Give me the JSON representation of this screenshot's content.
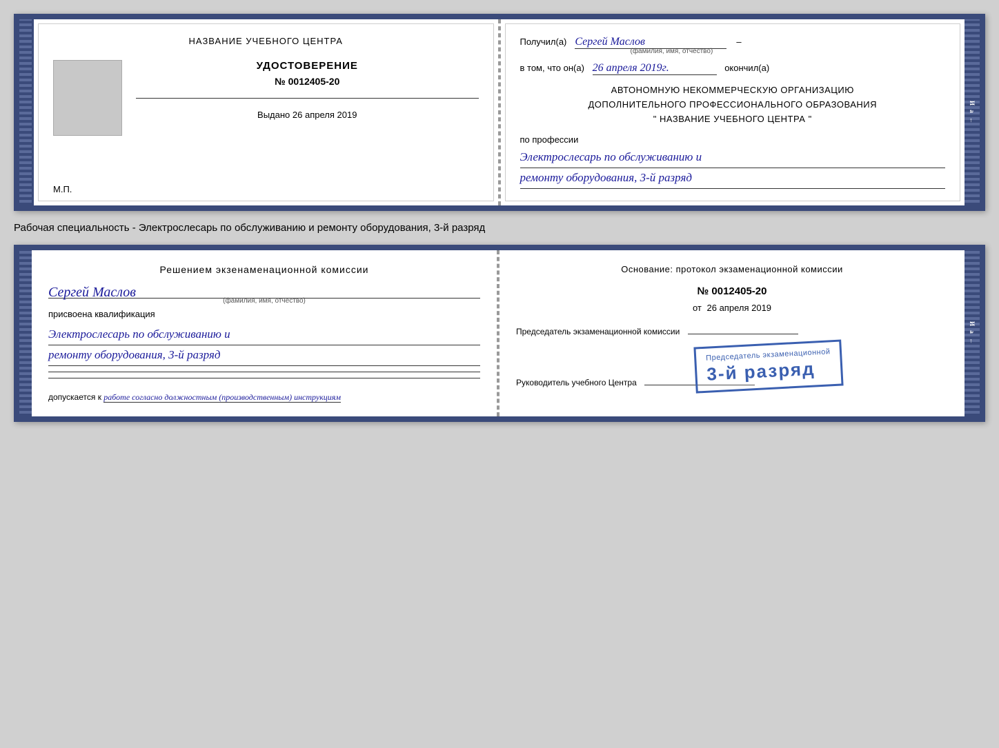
{
  "top_cert": {
    "left": {
      "heading": "НАЗВАНИЕ УЧЕБНОГО ЦЕНТРА",
      "cert_title": "УДОСТОВЕРЕНИЕ",
      "cert_number": "№ 0012405-20",
      "issued_label": "Выдано",
      "issued_date": "26 апреля 2019",
      "mp_label": "М.П."
    },
    "right": {
      "received_label": "Получил(а)",
      "fio_handwritten": "Сергей Маслов",
      "fio_subtitle": "(фамилия, имя, отчество)",
      "dash": "–",
      "in_that_label": "в том, что он(а)",
      "date_handwritten": "26 апреля 2019г.",
      "finished_label": "окончил(а)",
      "org_line1": "АВТОНОМНУЮ НЕКОММЕРЧЕСКУЮ ОРГАНИЗАЦИЮ",
      "org_line2": "ДОПОЛНИТЕЛЬНОГО ПРОФЕССИОНАЛЬНОГО ОБРАЗОВАНИЯ",
      "org_name": "\" НАЗВАНИЕ УЧЕБНОГО ЦЕНТРА \"",
      "profession_label": "по профессии",
      "profession_handwritten1": "Электрослесарь по обслуживанию и",
      "profession_handwritten2": "ремонту оборудования, 3-й разряд"
    }
  },
  "between_label": "Рабочая специальность - Электрослесарь по обслуживанию и ремонту оборудования, 3-й разряд",
  "bottom_cert": {
    "left": {
      "decision_label": "Решением экзенаменационной комиссии",
      "fio_handwritten": "Сергей Маслов",
      "fio_subtitle": "(фамилия, имя, отчество)",
      "assigned_label": "присвоена квалификация",
      "qualification_handwritten1": "Электрослесарь по обслуживанию и",
      "qualification_handwritten2": "ремонту оборудования, 3-й разряд",
      "admitted_label": "допускается к",
      "admitted_handwritten": "работе согласно должностным (производственным) инструкциям"
    },
    "right": {
      "basis_label": "Основание: протокол экзаменационной комиссии",
      "number_label": "№",
      "number_value": "0012405-20",
      "date_prefix": "от",
      "date_value": "26 апреля 2019",
      "chairman_label": "Председатель экзаменационной комиссии",
      "director_label": "Руководитель учебного Центра"
    },
    "stamp": {
      "title": "Председатель экзаменационной",
      "text": "3-й разряд"
    }
  }
}
